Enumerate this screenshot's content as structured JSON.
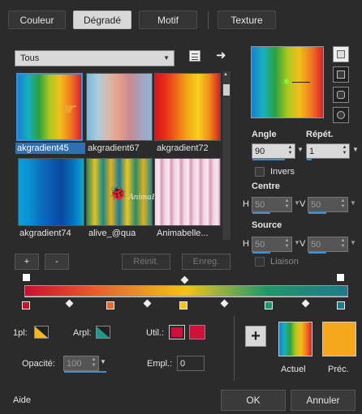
{
  "tabs": [
    {
      "label": "Couleur",
      "active": false
    },
    {
      "label": "Dégradé",
      "active": true
    },
    {
      "label": "Motif",
      "active": false
    },
    {
      "label": "Texture",
      "active": false
    }
  ],
  "filter": {
    "selected": "Tous"
  },
  "gradients": [
    {
      "label": "akgradient45",
      "selected": true
    },
    {
      "label": "akgradient67",
      "selected": false
    },
    {
      "label": "akgradient72",
      "selected": false
    },
    {
      "label": "akgradient74",
      "selected": false
    },
    {
      "label": "alive_@qua",
      "selected": false
    },
    {
      "label": "Animabelle...",
      "selected": false
    }
  ],
  "watermark": "AnimaBelle",
  "list_buttons": {
    "add": "+",
    "remove": "-",
    "reset": "Réinit.",
    "save": "Enreg."
  },
  "angle": {
    "label": "Angle",
    "value": "90"
  },
  "repeat": {
    "label": "Répét.",
    "value": "1"
  },
  "invert": {
    "label": "Invers",
    "checked": false
  },
  "center": {
    "label": "Centre",
    "h_label": "H",
    "h": "50",
    "v_label": "V",
    "v": "50"
  },
  "source": {
    "label": "Source",
    "h_label": "H",
    "h": "50",
    "v_label": "V",
    "v": "50"
  },
  "link": {
    "label": "Liaison",
    "checked": false
  },
  "stop_colors": [
    "#c8102e",
    "#e86a2a",
    "#f4c21a",
    "#1a9a6a",
    "#1e7a8c"
  ],
  "stop_editor": {
    "first_label": "1pl:",
    "arpl_label": "Arpl:",
    "util_label": "Util.:",
    "opacity_label": "Opacité:",
    "opacity_value": "100",
    "location_label": "Empl.:",
    "location_value": "0",
    "color_main": "#d0103a"
  },
  "preview": {
    "current_label": "Actuel",
    "previous_label": "Préc.",
    "previous_color": "#f5a81c"
  },
  "footer": {
    "help": "Aide",
    "ok": "OK",
    "cancel": "Annuler"
  }
}
